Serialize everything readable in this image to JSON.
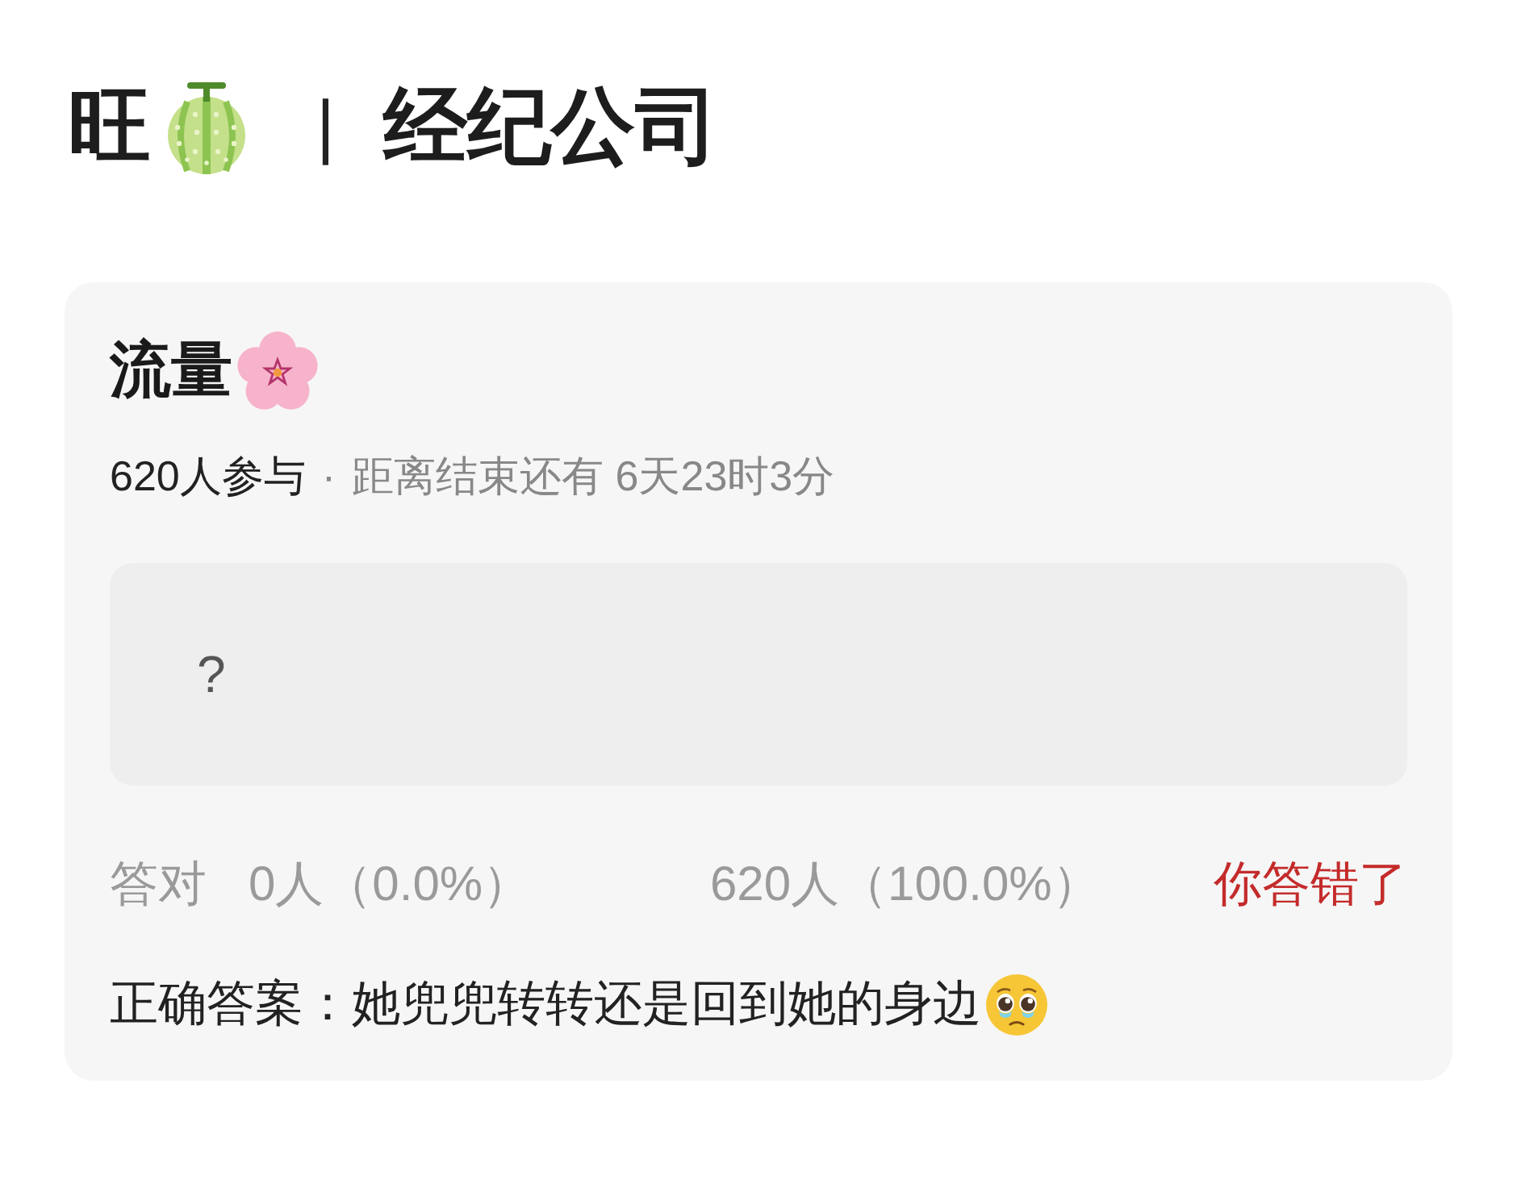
{
  "header": {
    "name": "旺",
    "separator": "|",
    "subtitle": "经纪公司"
  },
  "quiz": {
    "title": "流量",
    "participants": "620人参与",
    "dot": "·",
    "countdown": "距离结束还有 6天23时3分",
    "question": "?",
    "stats": {
      "label": "答对",
      "correct_count": "0人（0.0%）",
      "wrong_count": "620人（100.0%）"
    },
    "verdict": "你答错了",
    "answer": "正确答案：她兜兜转转还是回到她的身边"
  }
}
